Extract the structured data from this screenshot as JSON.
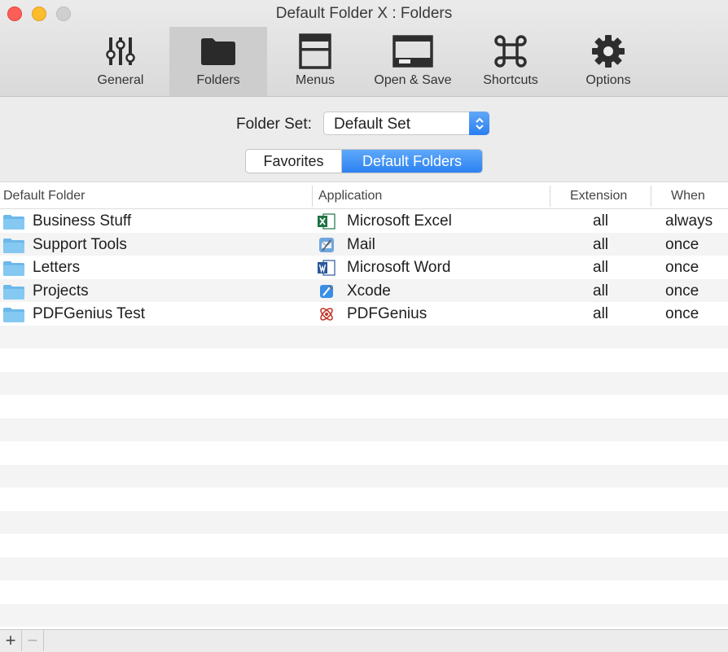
{
  "window": {
    "title": "Default Folder X : Folders"
  },
  "toolbar": {
    "items": [
      {
        "label": "General",
        "icon": "sliders-icon"
      },
      {
        "label": "Folders",
        "icon": "folder-icon",
        "selected": true
      },
      {
        "label": "Menus",
        "icon": "menu-window-icon"
      },
      {
        "label": "Open & Save",
        "icon": "open-save-window-icon"
      },
      {
        "label": "Shortcuts",
        "icon": "command-icon"
      },
      {
        "label": "Options",
        "icon": "gear-icon"
      }
    ]
  },
  "folder_set": {
    "label": "Folder Set:",
    "value": "Default Set"
  },
  "segments": {
    "favorites": "Favorites",
    "default_folders": "Default Folders",
    "selected": "default_folders"
  },
  "table": {
    "headers": {
      "folder": "Default Folder",
      "application": "Application",
      "extension": "Extension",
      "when": "When"
    },
    "rows": [
      {
        "folder": "Business Stuff",
        "app": "Microsoft Excel",
        "app_icon": "excel-icon",
        "extension": "all",
        "when": "always"
      },
      {
        "folder": "Support Tools",
        "app": "Mail",
        "app_icon": "mail-icon",
        "extension": "all",
        "when": "once"
      },
      {
        "folder": "Letters",
        "app": "Microsoft Word",
        "app_icon": "word-icon",
        "extension": "all",
        "when": "once"
      },
      {
        "folder": "Projects",
        "app": "Xcode",
        "app_icon": "xcode-icon",
        "extension": "all",
        "when": "once"
      },
      {
        "folder": "PDFGenius Test",
        "app": "PDFGenius",
        "app_icon": "pdfgenius-icon",
        "extension": "all",
        "when": "once"
      }
    ]
  },
  "bottom_bar": {
    "add": "+",
    "remove": "−"
  },
  "colors": {
    "accent": "#2d82f1",
    "folder": "#6cb8ea",
    "stripe": "#f3f3f3"
  }
}
